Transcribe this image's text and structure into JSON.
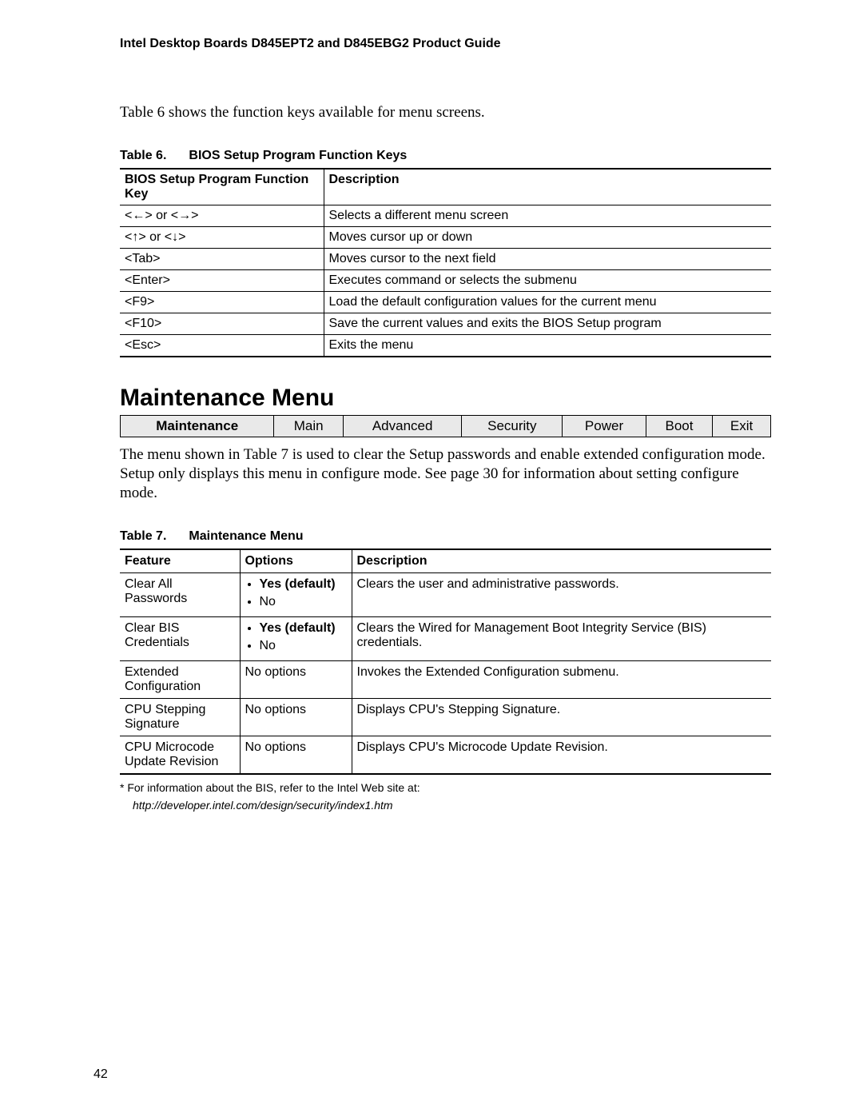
{
  "header": "Intel Desktop Boards D845EPT2 and D845EBG2 Product Guide",
  "intro": "Table 6 shows the function keys available for menu screens.",
  "table6": {
    "caption_a": "Table 6.",
    "caption_b": "BIOS Setup Program Function Keys",
    "headers": [
      "BIOS Setup Program Function Key",
      "Description"
    ],
    "rows": [
      [
        "<←> or <→>",
        "Selects a different menu screen"
      ],
      [
        "<↑> or <↓>",
        "Moves cursor up or down"
      ],
      [
        "<Tab>",
        "Moves cursor to the next field"
      ],
      [
        "<Enter>",
        "Executes command or selects the submenu"
      ],
      [
        "<F9>",
        "Load the default configuration values for the current menu"
      ],
      [
        "<F10>",
        "Save the current values and exits the BIOS Setup program"
      ],
      [
        "<Esc>",
        "Exits the menu"
      ]
    ]
  },
  "section_title": "Maintenance Menu",
  "menubar": [
    "Maintenance",
    "Main",
    "Advanced",
    "Security",
    "Power",
    "Boot",
    "Exit"
  ],
  "menubar_active_index": 0,
  "para": "The menu shown in Table 7 is used to clear the Setup passwords and enable extended configuration mode.  Setup only displays this menu in configure mode.  See page 30 for information about setting configure mode.",
  "table7": {
    "caption_a": "Table 7.",
    "caption_b": "Maintenance Menu",
    "headers": [
      "Feature",
      "Options",
      "Description"
    ],
    "rows": [
      {
        "feature": "Clear All Passwords",
        "options": [
          {
            "label": "Yes (default)",
            "default": true
          },
          {
            "label": "No",
            "default": false
          }
        ],
        "options_plain": "",
        "description": "Clears the user and administrative passwords."
      },
      {
        "feature": "Clear BIS Credentials",
        "options": [
          {
            "label": "Yes (default)",
            "default": true
          },
          {
            "label": "No",
            "default": false
          }
        ],
        "options_plain": "",
        "description": "Clears the Wired for Management Boot Integrity Service (BIS) credentials."
      },
      {
        "feature": "Extended Configuration",
        "options": [],
        "options_plain": "No options",
        "description": "Invokes the Extended Configuration submenu."
      },
      {
        "feature": "CPU Stepping Signature",
        "options": [],
        "options_plain": "No options",
        "description": "Displays CPU's Stepping Signature."
      },
      {
        "feature": "CPU Microcode Update Revision",
        "options": [],
        "options_plain": "No options",
        "description": "Displays CPU's Microcode Update Revision."
      }
    ]
  },
  "footnote_star": "*  For information about the BIS, refer to the Intel Web site at:",
  "footnote_url": "http://developer.intel.com/design/security/index1.htm",
  "page_number": "42"
}
